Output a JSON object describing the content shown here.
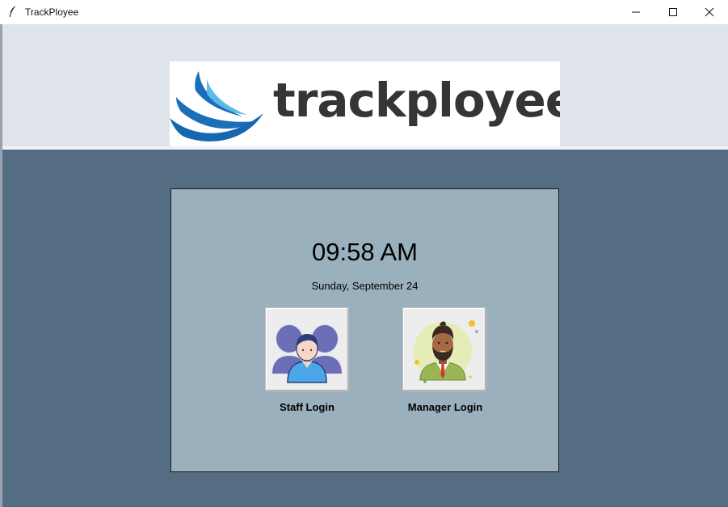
{
  "window": {
    "title": "TrackPloyee",
    "controls": [
      "minimize",
      "maximize",
      "close"
    ]
  },
  "header": {
    "logo_text": "trackployee"
  },
  "panel": {
    "time": "09:58 AM",
    "date": "Sunday, September 24",
    "staff_login_label": "Staff Login",
    "manager_login_label": "Manager Login"
  },
  "icons": {
    "app": "feather-icon",
    "staff": "staff-group-avatar-icon",
    "manager": "manager-avatar-icon"
  },
  "colors": {
    "background": "#556d82",
    "header": "#dfe4eb",
    "panel": "#9bb0bd",
    "logo_blue": "#1a6fb8",
    "logo_light_blue": "#5bbbe8",
    "logo_text": "#353535"
  }
}
